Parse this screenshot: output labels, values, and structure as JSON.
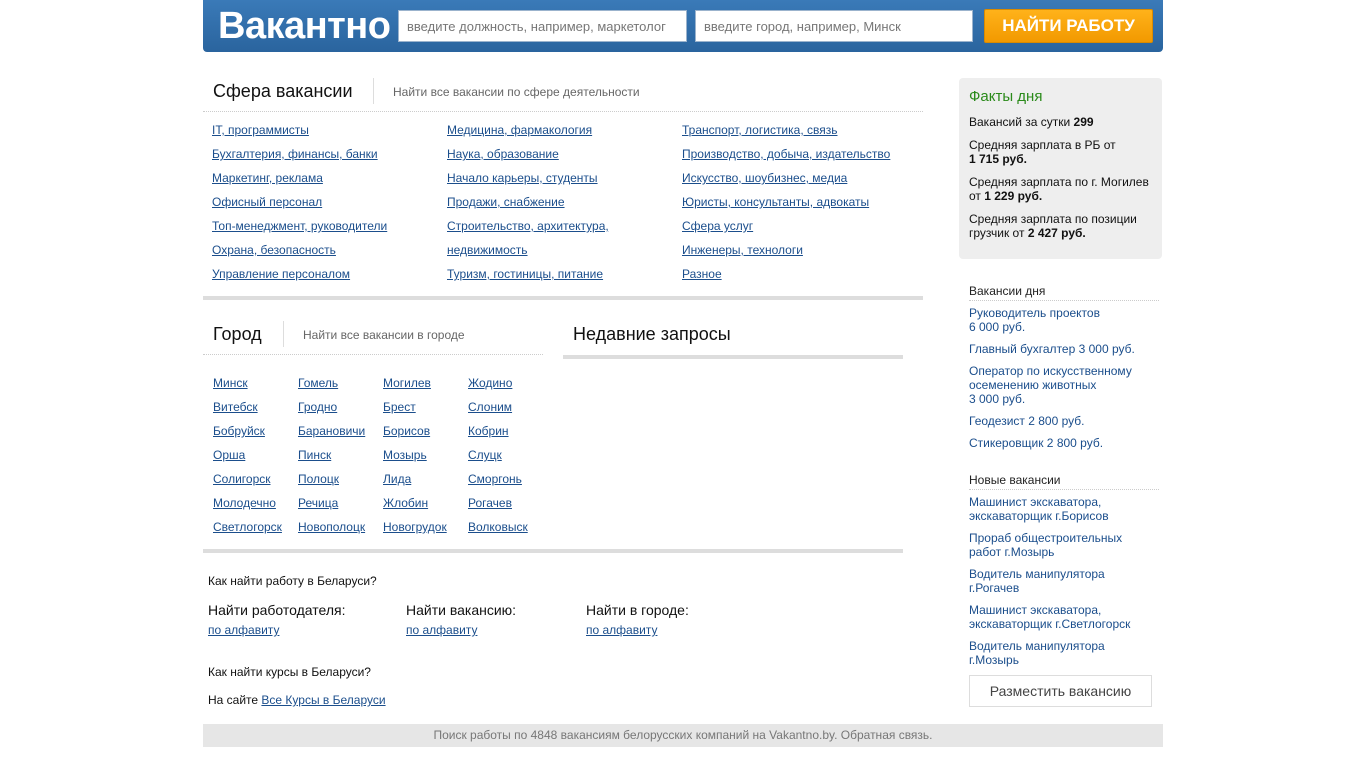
{
  "header": {
    "logo": "Вакантно",
    "position_placeholder": "введите должность, например, маркетолог",
    "city_placeholder": "введите город, например, Минск",
    "find_button": "НАЙТИ РАБОТУ"
  },
  "sphere": {
    "title": "Сфера вакансии",
    "subtitle": "Найти все вакансии по сфере деятельности",
    "col1": [
      "IT, программисты",
      "Бухгалтерия, финансы, банки",
      "Маркетинг, реклама",
      "Офисный персонал",
      "Топ-менеджмент, руководители",
      "Охрана, безопасность",
      "Управление персоналом"
    ],
    "col2": [
      "Медицина, фармакология",
      "Наука, образование",
      "Начало карьеры, студенты",
      "Продажи, снабжение",
      "Строительство, архитектура,",
      "недвижимость",
      "Туризм, гостиницы, питание"
    ],
    "col3": [
      "Транспорт, логистика, связь",
      "Производство, добыча, издательство",
      "Искусство, шоубизнес, медиа",
      "Юристы, консультанты, адвокаты",
      "Сфера услуг",
      "Инженеры, технологи",
      "Разное"
    ]
  },
  "city": {
    "title": "Город",
    "subtitle": "Найти все вакансии в городе",
    "col1": [
      "Минск",
      "Витебск",
      "Бобруйск",
      "Орша",
      "Солигорск",
      "Молодечно",
      "Светлогорск"
    ],
    "col2": [
      "Гомель",
      "Гродно",
      "Барановичи",
      "Пинск",
      "Полоцк",
      "Речица",
      "Новополоцк"
    ],
    "col3": [
      "Могилев",
      "Брест",
      "Борисов",
      "Мозырь",
      "Лида",
      "Жлобин",
      "Новогрудок"
    ],
    "col4": [
      "Жодино",
      "Слоним",
      "Кобрин",
      "Слуцк",
      "Сморгонь",
      "Рогачев",
      "Волковыск"
    ]
  },
  "recent": {
    "title": "Недавние запросы"
  },
  "how": {
    "question": "Как найти работу в Беларуси?",
    "employer_head": "Найти работодателя:",
    "employer_link": "по алфавиту",
    "vacancy_head": "Найти вакансию:",
    "vacancy_link": "по алфавиту",
    "city_head": "Найти в городе:",
    "city_link": "по алфавиту",
    "courses_question": "Как найти курсы в Беларуси?",
    "site_prefix": "На сайте ",
    "site_link": "Все Курсы в Беларуси"
  },
  "facts": {
    "title": "Факты дня",
    "l1_text": "Вакансий за сутки ",
    "l1_val": "299",
    "l2_text": "Средняя зарплата в РБ от",
    "l2_val": "1 715 руб.",
    "l3_text": "Средняя зарплата по г. Могилев от ",
    "l3_val": "1 229 руб.",
    "l4_text": "Средняя зарплата по позиции грузчик от ",
    "l4_val": "2 427 руб."
  },
  "day_vacancies": {
    "title": "Вакансии дня",
    "items": [
      "Руководитель проектов\n6 000 руб.",
      "Главный бухгалтер 3 000 руб.",
      "Оператор по искусственному осеменению животных\n3 000 руб.",
      "Геодезист 2 800 руб.",
      "Стикеровщик 2 800 руб."
    ]
  },
  "new_vacancies": {
    "title": "Новые вакансии",
    "items": [
      "Машинист экскаватора, экскаваторщик  г.Борисов",
      "Прораб общестроительных работ  г.Мозырь",
      "Водитель манипулятора\n г.Рогачев",
      "Машинист экскаватора, экскаваторщик  г.Светлогорск",
      "Водитель манипулятора\n г.Мозырь"
    ]
  },
  "post_button": "Разместить вакансию",
  "footer": "Поиск работы по 4848 вакансиям белорусских компаний на Vakantno.by. Обратная связь."
}
